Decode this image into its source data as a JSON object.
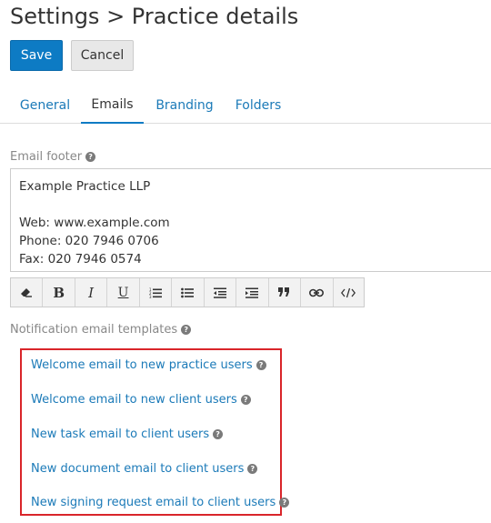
{
  "header": {
    "title": "Settings > Practice details"
  },
  "actions": {
    "save_label": "Save",
    "cancel_label": "Cancel"
  },
  "tabs": [
    {
      "label": "General",
      "active": false
    },
    {
      "label": "Emails",
      "active": true
    },
    {
      "label": "Branding",
      "active": false
    },
    {
      "label": "Folders",
      "active": false
    }
  ],
  "email_footer": {
    "label": "Email footer",
    "lines": [
      "Example Practice LLP",
      "",
      "Web: www.example.com",
      "Phone: 020 7946 0706",
      "Fax: 020 7946 0574"
    ]
  },
  "toolbar": {
    "buttons": [
      "eraser-icon",
      "bold-icon",
      "italic-icon",
      "underline-icon",
      "ordered-list-icon",
      "unordered-list-icon",
      "outdent-icon",
      "indent-icon",
      "blockquote-icon",
      "link-icon",
      "code-icon"
    ]
  },
  "notification_templates": {
    "label": "Notification email templates",
    "items": [
      "Welcome email to new practice users",
      "Welcome email to new client users",
      "New task email to client users",
      "New document email to client users",
      "New signing request email to client users"
    ]
  },
  "colors": {
    "primary": "#0d7bc4",
    "link": "#1b7ab8",
    "highlight_border": "#d9252a"
  }
}
